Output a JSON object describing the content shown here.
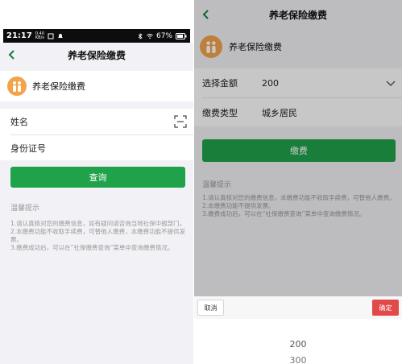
{
  "left": {
    "status": {
      "time": "21:17",
      "net_top": "0.40",
      "net_bottom": "KB/s",
      "battery": "67%"
    },
    "nav_title": "养老保险缴费",
    "service_name": "养老保险缴费",
    "form": {
      "name_label": "姓名",
      "id_label": "身份证号"
    },
    "query_button": "查询",
    "tips": {
      "title": "温馨提示",
      "items": [
        "1.请认真核对您的缴费信息，如有疑问请咨询当地社保中报部门。",
        "2.本缴费功能不收取手续费，可替他人缴费，本缴费功能不提供发票。",
        "3.缴费成功后，可以在“社保缴费查询”菜单中查询缴费情况。"
      ]
    }
  },
  "right": {
    "nav_title": "养老保险缴费",
    "service_name": "养老保险缴费",
    "amount_label": "选择金额",
    "amount_value": "200",
    "type_label": "缴费类型",
    "type_value": "城乡居民",
    "pay_button": "缴费",
    "tips": {
      "title": "温馨提示",
      "items": [
        "1.请认真核对您的缴费信息，本缴费功能不收取手续费，可替他人缴费。",
        "2.本缴费功能不提供发票。",
        "3.缴费成功后，可以在“社保缴费查询”菜单中查询缴费情况。"
      ]
    },
    "picker": {
      "cancel": "取消",
      "confirm": "确定",
      "options": [
        "200",
        "300"
      ]
    }
  },
  "colors": {
    "accent_green": "#1fa24a",
    "confirm_red": "#e24a4a",
    "logo_orange": "#f3a34a"
  }
}
